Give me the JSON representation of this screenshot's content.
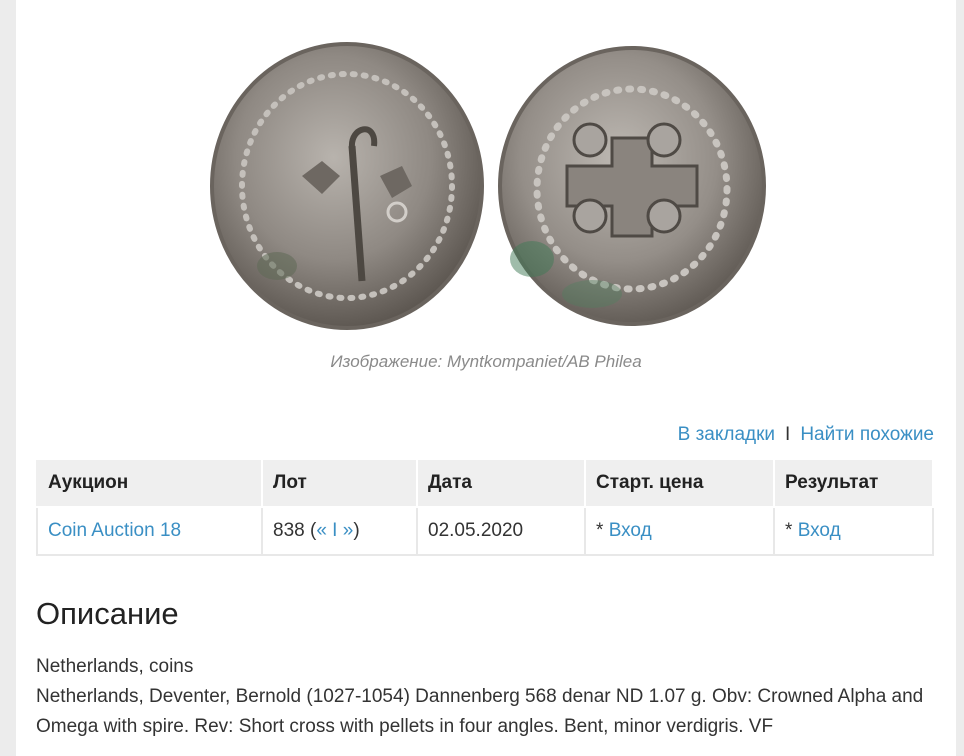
{
  "image": {
    "caption": "Изображение: Myntkompaniet/AB Philea"
  },
  "actions": {
    "bookmark": "В закладки",
    "separator": "I",
    "find_similar": "Найти похожие"
  },
  "table": {
    "headers": [
      "Аукцион",
      "Лот",
      "Дата",
      "Старт. цена",
      "Результат"
    ],
    "row": {
      "auction": "Coin Auction 18",
      "lot_number": "838",
      "lot_open": " (",
      "prev": "«",
      "nav_sep": " I ",
      "next": "»",
      "lot_close": ")",
      "date": "02.05.2020",
      "start_prefix": "* ",
      "start_link": "Вход",
      "result_prefix": "* ",
      "result_link": "Вход"
    }
  },
  "description": {
    "title": "Описание",
    "category": "Netherlands, coins",
    "text": "Netherlands, Deventer, Bernold (1027-1054) Dannenberg 568 denar ND 1.07 g. Obv: Crowned Alpha and Omega with spire. Rev: Short cross with pellets in four angles. Bent, minor verdigris. VF"
  },
  "colors": {
    "link": "#3a8fc4",
    "header_bg": "#efefef",
    "page_bg": "#ececec"
  }
}
